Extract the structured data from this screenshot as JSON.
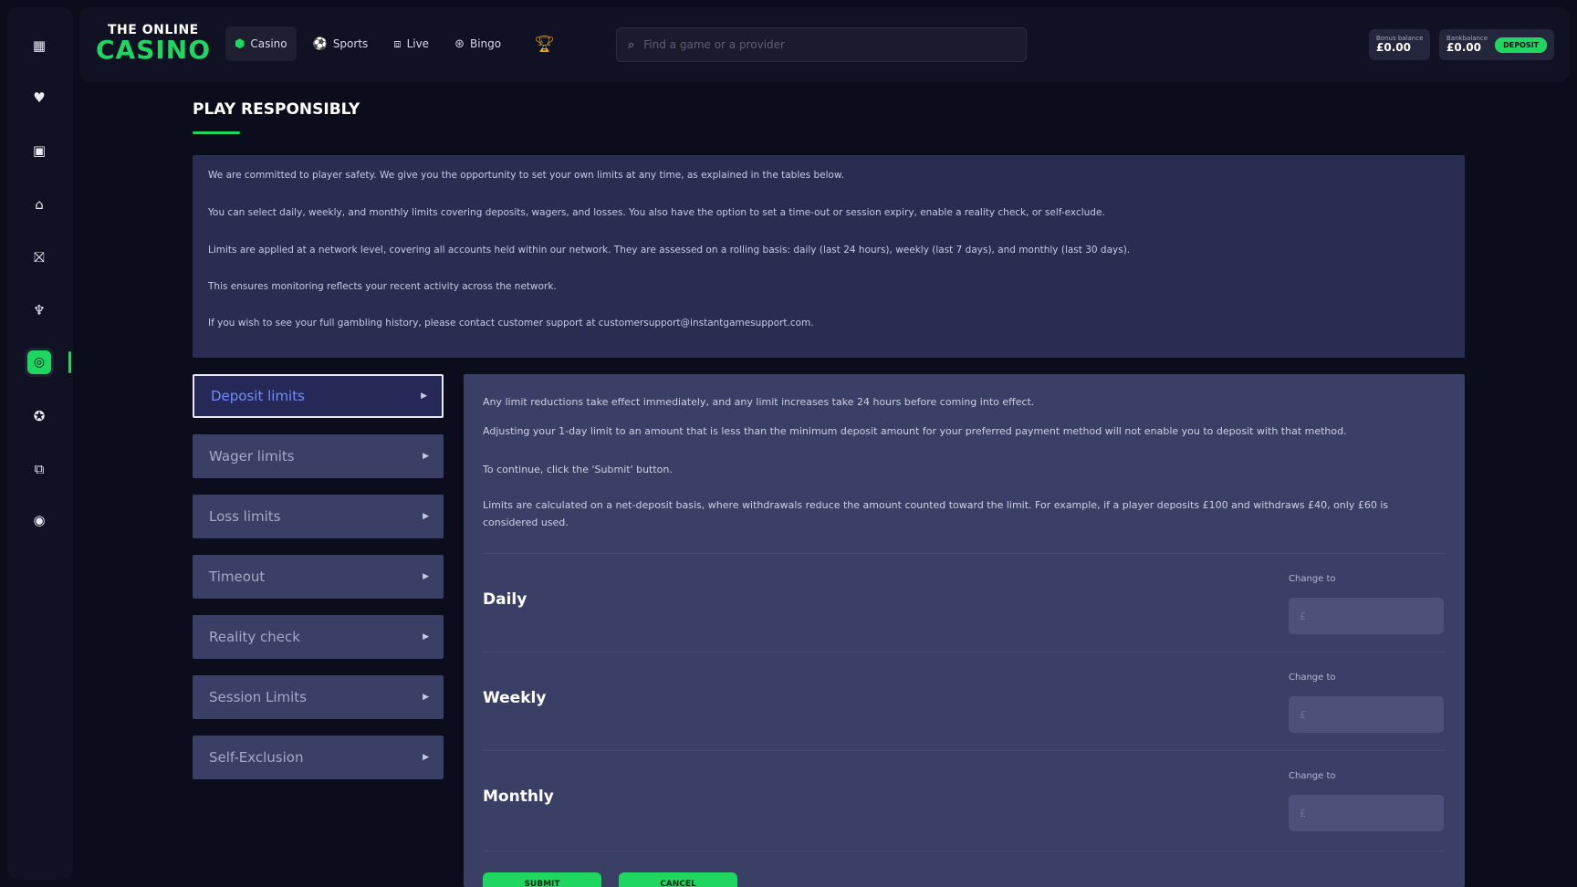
{
  "rail": {
    "items": [
      "grid",
      "heart",
      "slot",
      "home",
      "gift",
      "trophy",
      "casino-active",
      "settings",
      "chat",
      "support"
    ]
  },
  "logo": {
    "line1": "THE ONLINE",
    "line2": "CASINO"
  },
  "nav": [
    {
      "label": "Casino",
      "icon": "chip-icon"
    },
    {
      "label": "Sports",
      "icon": "ball-icon"
    },
    {
      "label": "Live",
      "icon": "live-icon"
    },
    {
      "label": "Bingo",
      "icon": "bingo-icon"
    }
  ],
  "search": {
    "placeholder": "Find a game or a provider"
  },
  "balances": {
    "bonus_label": "Bonus balance",
    "bonus_value": "£0.00",
    "bank_label": "Bankbalance",
    "bank_value": "£0.00",
    "deposit_label": "DEPOSIT"
  },
  "page": {
    "title": "PLAY RESPONSIBLY"
  },
  "info": [
    "We are committed to player safety. We give you the opportunity to set your own limits at any time, as explained in the tables below.",
    "You can select daily, weekly, and monthly limits covering deposits, wagers, and losses. You also have the option to set a time-out or session expiry, enable a reality check, or self-exclude.",
    "Limits are applied at a network level, covering all accounts held within our network. They are assessed on a rolling basis: daily (last 24 hours), weekly (last 7 days), and monthly (last 30 days).",
    "This ensures monitoring reflects your recent activity across the network.",
    "If you wish to see your full gambling history, please contact customer support at customersupport@instantgamesupport.com."
  ],
  "tabs": [
    "Deposit limits",
    "Wager limits",
    "Loss limits",
    "Timeout",
    "Reality check",
    "Session Limits",
    "Self-Exclusion"
  ],
  "panel": {
    "notes": [
      "Any limit reductions take effect immediately, and any limit increases take 24 hours before coming into effect.",
      "Adjusting your 1-day limit to an amount that is less than the minimum deposit amount for your preferred payment method will not enable you to deposit with that method.",
      "To continue, click the 'Submit' button.",
      "Limits are calculated on a net-deposit basis, where withdrawals reduce the amount counted toward the limit. For example, if a player deposits £100 and withdraws £40, only £60 is considered used."
    ],
    "rows": [
      {
        "label": "Daily",
        "change_label": "Change to",
        "placeholder": "£"
      },
      {
        "label": "Weekly",
        "change_label": "Change to",
        "placeholder": "£"
      },
      {
        "label": "Monthly",
        "change_label": "Change to",
        "placeholder": "£"
      }
    ],
    "submit_label": "SUBMIT",
    "cancel_label": "CANCEL"
  },
  "colors": {
    "accent": "#1fd760",
    "panel": "#3a3f65",
    "info": "#2b2c52",
    "active_tab_text": "#6f8cff"
  }
}
